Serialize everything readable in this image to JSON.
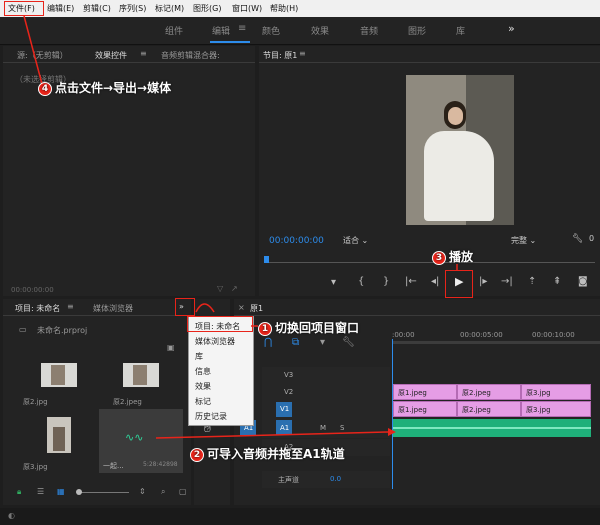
{
  "menubar": {
    "items": [
      "文件(F)",
      "编辑(E)",
      "剪辑(C)",
      "序列(S)",
      "标记(M)",
      "图形(G)",
      "窗口(W)",
      "帮助(H)"
    ]
  },
  "workspaces": {
    "tabs": [
      "组件",
      "编辑",
      "颜色",
      "效果",
      "音频",
      "图形",
      "库"
    ],
    "active": "编辑",
    "more_icon": "»"
  },
  "source_panel": {
    "tabs": [
      "源:（无剪辑）",
      "效果控件",
      "音频剪辑混合器:"
    ],
    "placeholder": "（未选择剪辑）",
    "timecode": "00:00:00:00"
  },
  "program_panel": {
    "title": "节目: 原1",
    "timecode": "00:00:00:00",
    "fit": "适合",
    "quality": "完整"
  },
  "project_panel": {
    "tabs": [
      "项目: 未命名",
      "媒体浏览器"
    ],
    "file": "未命名.prproj",
    "items": [
      {
        "name": "原2.jpg",
        "type": "photo"
      },
      {
        "name": "原2.jpeg",
        "type": "photo"
      },
      {
        "name": "原3.jpg",
        "type": "photo"
      },
      {
        "name": "一起...",
        "duration": "5:28:42898",
        "type": "audio"
      }
    ]
  },
  "context_menu": {
    "items": [
      "项目: 未命名",
      "媒体浏览器",
      "库",
      "信息",
      "效果",
      "标记",
      "历史记录"
    ]
  },
  "timeline": {
    "sequence": "原1",
    "timecode_ticks": [
      ":00:00",
      "00:00:05:00",
      "00:00:10:00"
    ],
    "tracks": [
      "V3",
      "V2",
      "V1",
      "A1",
      "A2"
    ],
    "master": "主声道",
    "master_value": "0.0",
    "a1_src": "A1",
    "clips_v2": [
      "原1.jpeg",
      "原2.jpeg",
      "原3.jpg"
    ],
    "clips_v1": [
      "原1.jpeg",
      "原2.jpeg",
      "原3.jpg"
    ]
  },
  "annotations": {
    "a1": {
      "num": "1",
      "text": "切换回项目窗口"
    },
    "a2": {
      "num": "2",
      "text": "可导入音频并拖至A1轨道"
    },
    "a3": {
      "num": "3",
      "text": "播放"
    },
    "a4": {
      "num": "4",
      "text": "点击文件→导出→媒体"
    }
  },
  "colors": {
    "accent": "#2d8ceb",
    "annotation": "#e8241a",
    "clip": "#e59de5",
    "audio": "#1fb07a"
  }
}
